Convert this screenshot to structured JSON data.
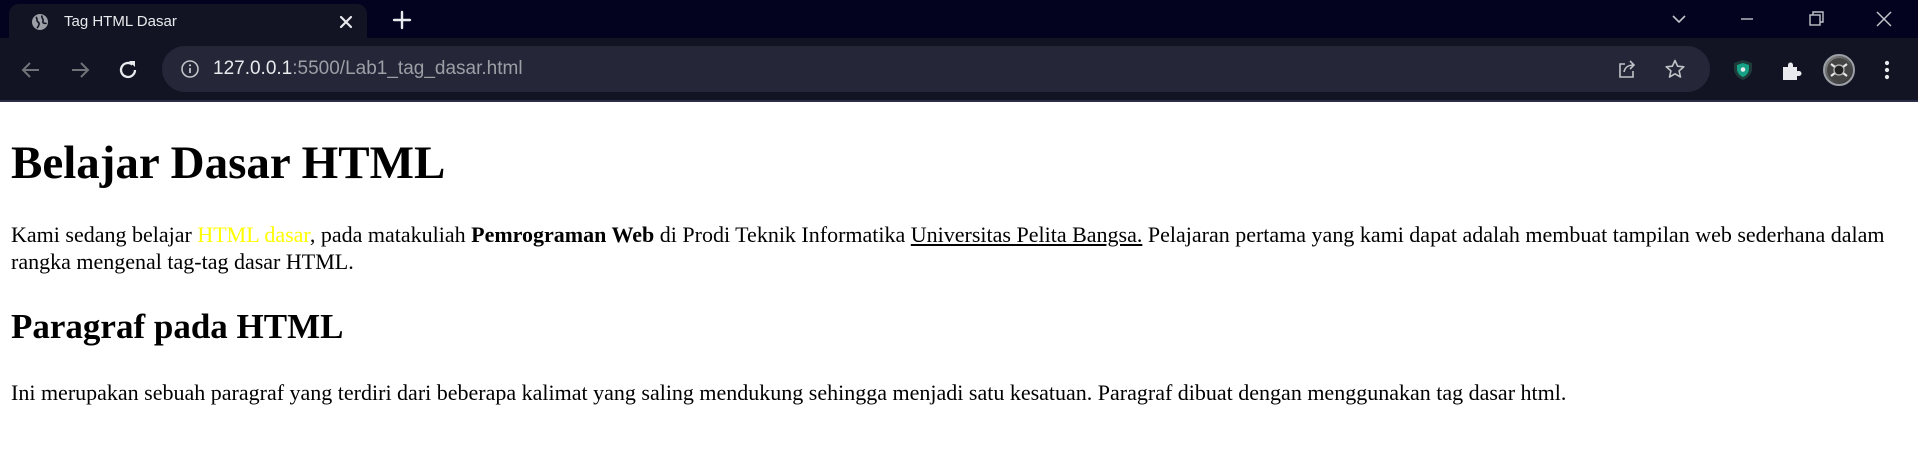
{
  "browser": {
    "tab": {
      "title": "Tag HTML Dasar",
      "favicon": "globe-icon"
    },
    "address_bar": {
      "url_host": "127.0.0.1",
      "url_rest": ":5500/Lab1_tag_dasar.html"
    },
    "icons": {
      "tab_close": "close-icon",
      "new_tab": "plus-icon",
      "tab_search": "chevron-down-icon",
      "minimize": "minimize-icon",
      "restore": "restore-icon",
      "close_window": "close-icon",
      "back": "arrow-left-icon",
      "forward": "arrow-right-icon",
      "reload": "reload-icon",
      "site_info": "info-icon",
      "share": "share-icon",
      "bookmark": "star-icon",
      "extension": "shield-icon",
      "extensions_menu": "puzzle-icon",
      "profile": "avatar",
      "menu": "more-vert-icon"
    },
    "colors": {
      "titlebar_bg": "#03031f",
      "toolbar_bg": "#131423",
      "omnibox_bg": "#252637",
      "extension_accent": "#16a085"
    }
  },
  "page": {
    "heading1": "Belajar Dasar HTML",
    "paragraph1": {
      "text_start": "Kami sedang belajar ",
      "highlight": "HTML dasar",
      "text_after_highlight": ", pada matakuliah ",
      "bold": "Pemrograman Web",
      "text_after_bold": " di Prodi Teknik Informatika ",
      "underlined": "Universitas Pelita Bangsa.",
      "text_end": " Pelajaran pertama yang kami dapat adalah membuat tampilan web sederhana dalam rangka mengenal tag-tag dasar HTML."
    },
    "heading2": "Paragraf pada HTML",
    "paragraph2": "Ini merupakan sebuah paragraf yang terdiri dari beberapa kalimat yang saling mendukung sehingga menjadi satu kesatuan. Paragraf dibuat dengan menggunakan tag dasar html.",
    "colors": {
      "highlight_text": "#ffff00"
    }
  }
}
